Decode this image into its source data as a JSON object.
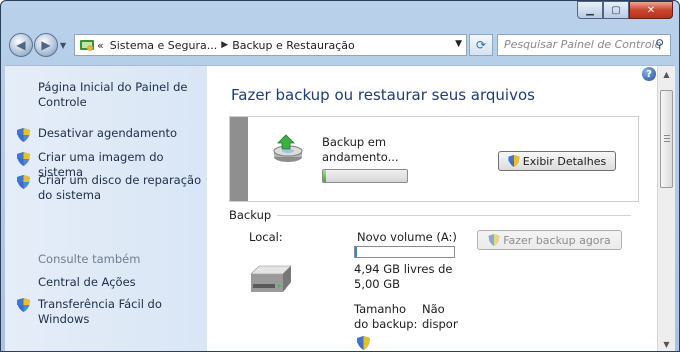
{
  "nav": {
    "breadcrumbs": [
      "Sistema e Segura...",
      "Backup e Restauração"
    ],
    "overflow_glyph": "«",
    "search_placeholder": "Pesquisar Painel de Controle"
  },
  "sidebar": {
    "home_link": "Página Inicial do Painel de Controle",
    "tasks": [
      {
        "label": "Desativar agendamento",
        "icon": "uac-shield-icon"
      },
      {
        "label": "Criar uma imagem do sistema",
        "icon": "uac-shield-icon"
      },
      {
        "label": "Criar um disco de reparação do sistema",
        "icon": "uac-shield-icon"
      }
    ],
    "see_also_title": "Consulte também",
    "see_also": [
      {
        "label": "Central de Ações"
      },
      {
        "label": "Transferência Fácil do Windows",
        "icon": "uac-shield-icon"
      }
    ]
  },
  "main": {
    "title": "Fazer backup ou restaurar seus arquivos",
    "status_text": "Backup em andamento...",
    "status_progress": 0.03,
    "details_button": "Exibir Detalhes",
    "section_backup": "Backup",
    "location_label": "Local:",
    "volume_name": "Novo volume (A:)",
    "volume_used_fraction": 0.01,
    "free_space": "4,94 GB livres de 5,00 GB",
    "backup_now_button": "Fazer backup agora",
    "backup_size_label": "Tamanho do backup:",
    "backup_size_value": "Não disponível"
  },
  "colors": {
    "title_blue": "#1e3c78",
    "progress_green": "#39b21d",
    "volume_blue": "#3a86d6"
  }
}
